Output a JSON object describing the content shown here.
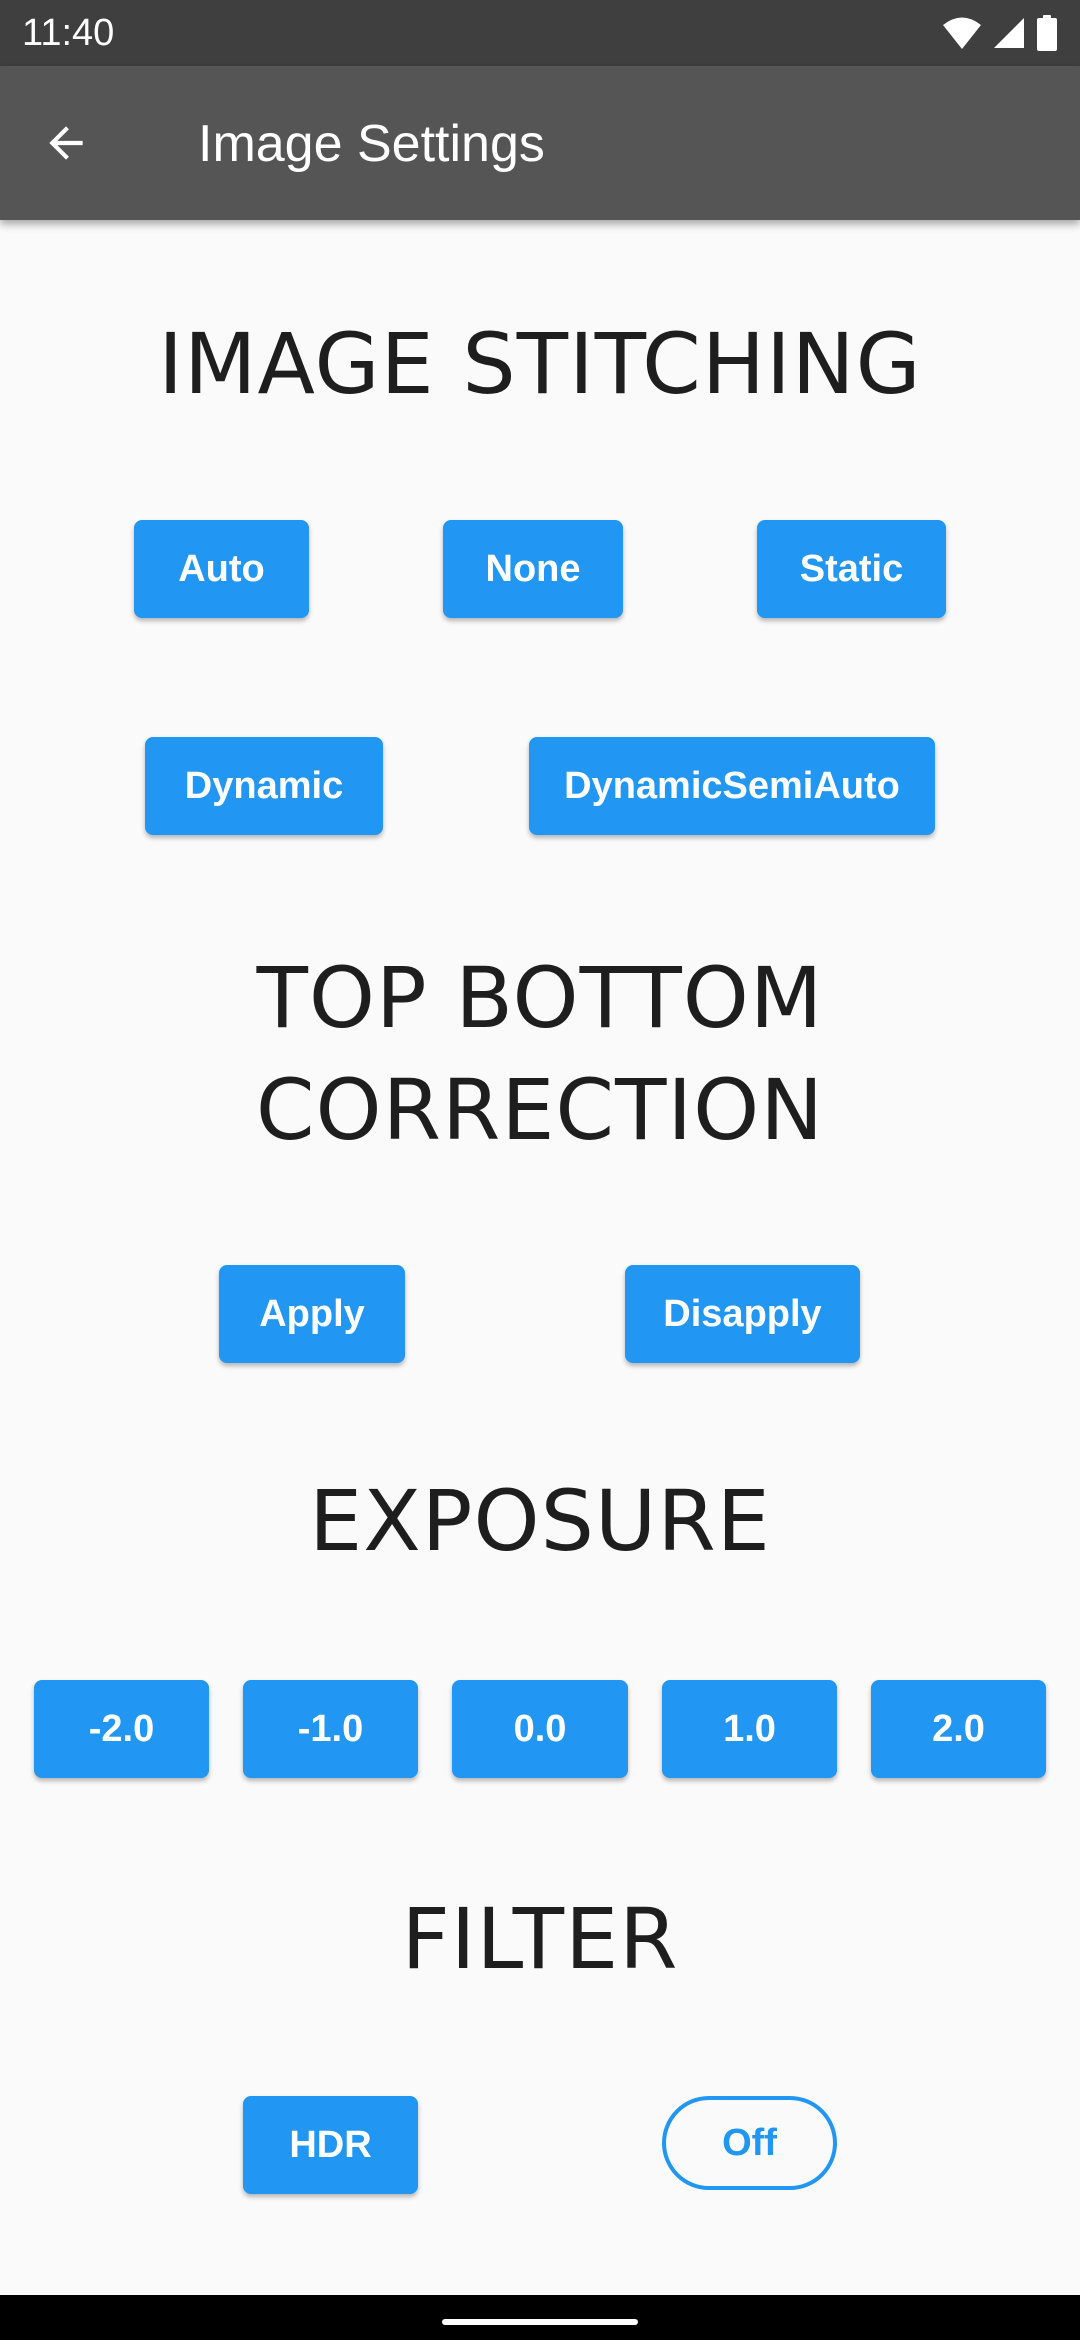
{
  "status_bar": {
    "time": "11:40",
    "icons": [
      "wifi-icon",
      "signal-icon",
      "battery-icon"
    ]
  },
  "app_bar": {
    "back_icon": "arrow-back-icon",
    "title": "Image Settings"
  },
  "sections": {
    "image_stitching": {
      "title": "IMAGE STITCHING",
      "buttons": [
        "Auto",
        "None",
        "Static",
        "Dynamic",
        "DynamicSemiAuto"
      ]
    },
    "top_bottom_correction": {
      "title_line1": "TOP BOTTOM",
      "title_line2": "CORRECTION",
      "buttons": [
        "Apply",
        "Disapply"
      ]
    },
    "exposure": {
      "title": "EXPOSURE",
      "buttons": [
        "-2.0",
        "-1.0",
        "0.0",
        "1.0",
        "2.0"
      ]
    },
    "filter": {
      "title": "FILTER",
      "buttons": [
        "HDR",
        "Off"
      ],
      "selected": "Off"
    }
  },
  "colors": {
    "accent": "#2196f3",
    "app_bar": "#555555",
    "status_bar": "#3f3f3f",
    "background": "#fafafa",
    "heading": "#1e1e1e"
  }
}
